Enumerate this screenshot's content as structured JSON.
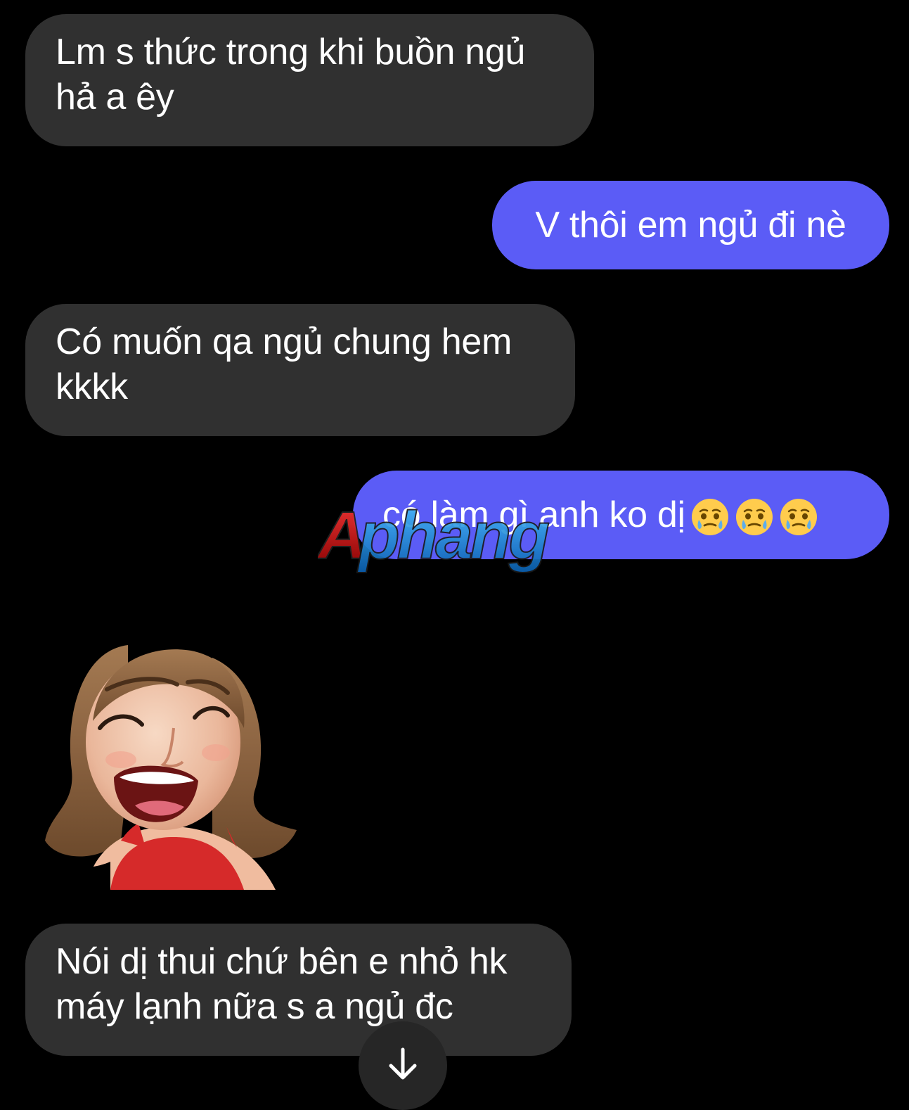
{
  "messages": [
    {
      "direction": "received",
      "text": "Lm s thức trong khi buồn ngủ\nhả a êy"
    },
    {
      "direction": "sent",
      "text": "V thôi em ngủ đi nè"
    },
    {
      "direction": "received",
      "text": "Có muốn qa ngủ chung hem\nkkkk"
    },
    {
      "direction": "sent",
      "text": "có làm gì anh ko dị",
      "emoji": "face-holding-back-tears-icon",
      "emoji_count": 3
    },
    {
      "direction": "received",
      "type": "sticker",
      "sticker": "laughing-girl-avatar-sticker"
    },
    {
      "direction": "received",
      "text": "Nói dị thui chứ bên e nhỏ hk\nmáy lạnh nữa s a ngủ đc"
    }
  ],
  "watermark": {
    "text": "Aphang"
  },
  "scroll_button": {
    "icon": "arrow-down-icon"
  },
  "colors": {
    "background": "#000000",
    "received_bubble": "#303030",
    "sent_bubble": "#5b5cf6",
    "text": "#ffffff",
    "scroll_button": "#262626"
  }
}
